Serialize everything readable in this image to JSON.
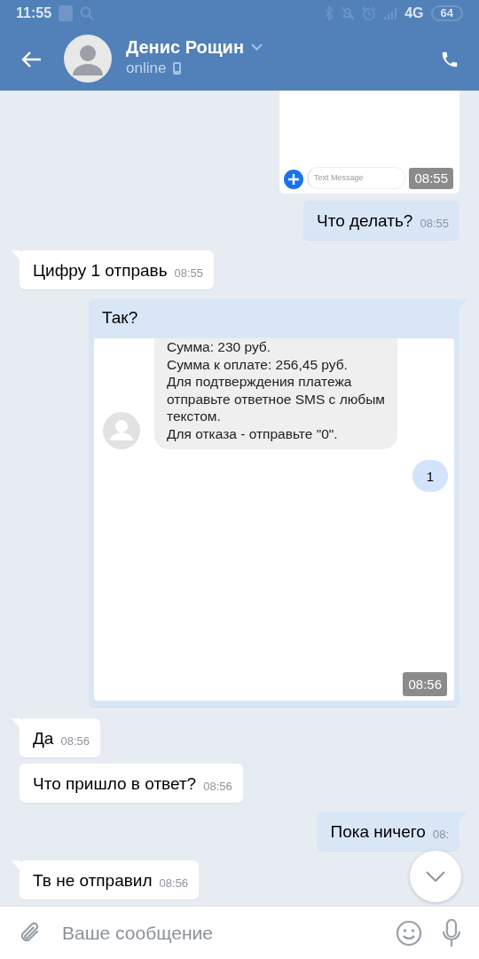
{
  "status_bar": {
    "time": "11:55",
    "network": "4G",
    "battery": "64"
  },
  "header": {
    "name": "Денис Рощин",
    "status": "online"
  },
  "messages": [
    {
      "kind": "attachment",
      "placeholder": "Text Message",
      "time": "08:55"
    },
    {
      "kind": "text",
      "outgoing": true,
      "tail": false,
      "text": "Что делать?",
      "time": "08:55"
    },
    {
      "kind": "text",
      "outgoing": false,
      "tail": true,
      "text": "Цифру 1 отправь",
      "time": "08:55"
    },
    {
      "kind": "screenshot",
      "outgoing": true,
      "tail": true,
      "text": "Так?",
      "sms_lines": [
        "Сумма: 230 руб.",
        "Сумма к оплате: 256,45 руб.",
        "Для подтверждения платежа",
        "отправьте ответное SMS с любым",
        "текстом.",
        "Для отказа - отправьте \"0\"."
      ],
      "reply": "1",
      "time": "08:56"
    },
    {
      "kind": "text",
      "outgoing": false,
      "tail": true,
      "text": "Да",
      "time": "08:56"
    },
    {
      "kind": "text",
      "outgoing": false,
      "tail": false,
      "text": "Что пришло в ответ?",
      "time": "08:56"
    },
    {
      "kind": "text",
      "outgoing": true,
      "tail": true,
      "text": "Пока ничего",
      "time": "08:"
    },
    {
      "kind": "text",
      "outgoing": false,
      "tail": true,
      "text": "Тв не отправил",
      "time": "08:56"
    }
  ],
  "composer": {
    "placeholder": "Ваше сообщение"
  }
}
